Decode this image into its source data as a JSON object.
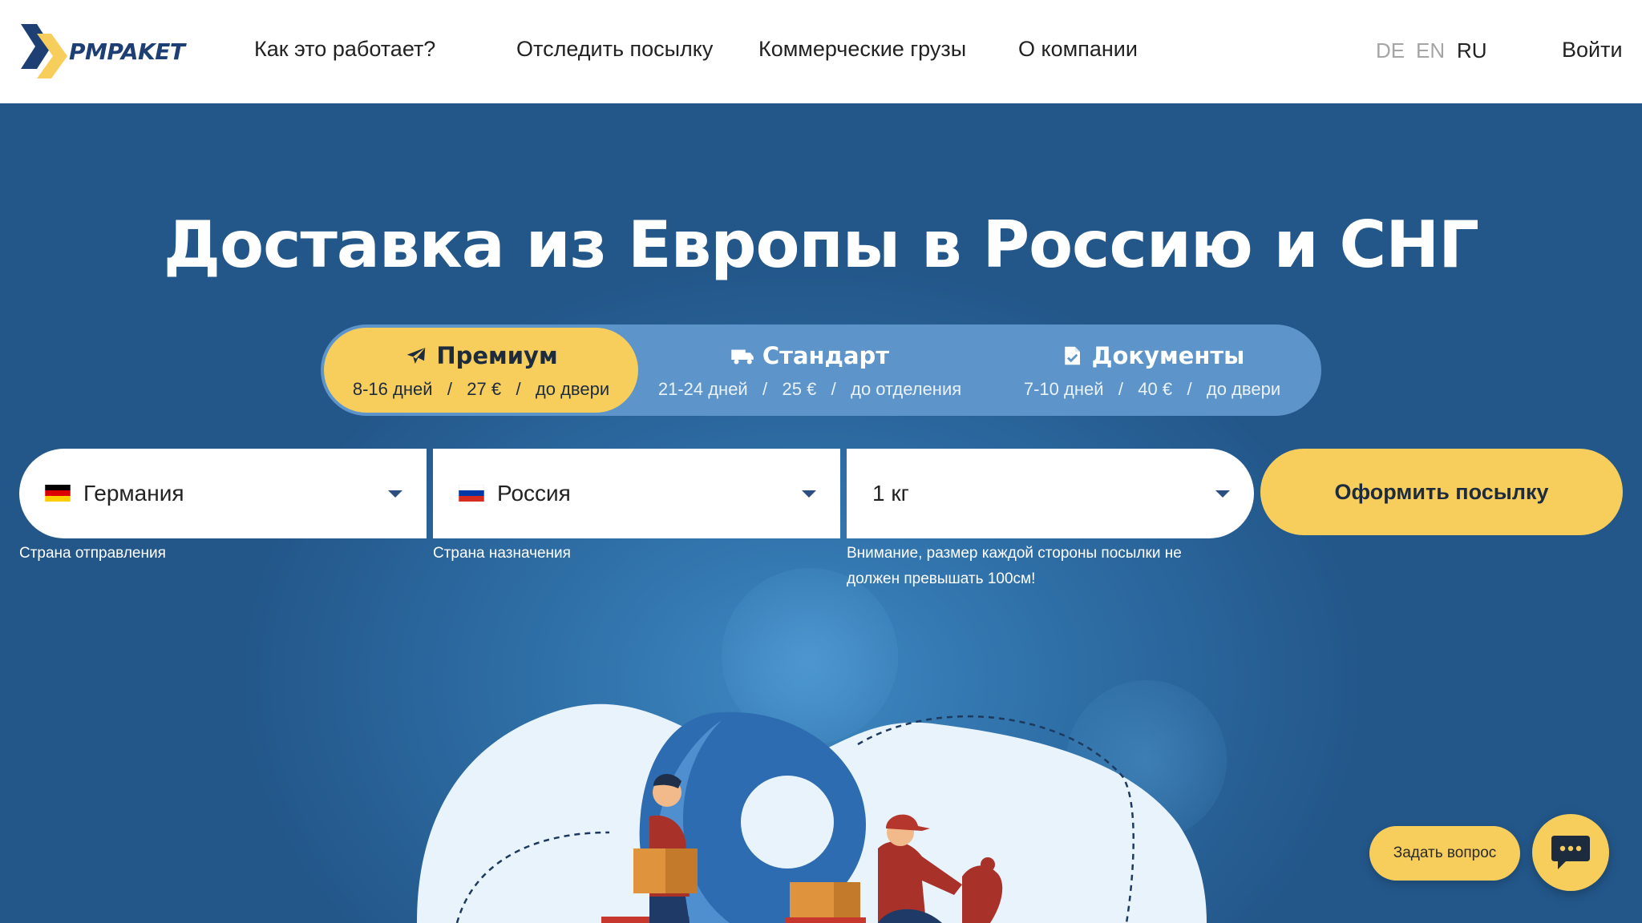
{
  "brand": {
    "name": "PMPAKET"
  },
  "nav": {
    "how_it_works": "Как это работает?",
    "track": "Отследить посылку",
    "commercial": "Коммерческие грузы",
    "about": "О компании"
  },
  "languages": [
    "DE",
    "EN",
    "RU"
  ],
  "active_language": "RU",
  "login": "Войти",
  "hero": {
    "title": "Доставка из Европы в Россию и СНГ"
  },
  "tabs": [
    {
      "title": "Премиум",
      "subtitle": "8-16 дней   /   27 €   /   до двери",
      "icon": "airplane-icon",
      "active": true
    },
    {
      "title": "Стандарт",
      "subtitle": "21-24 дней   /   25 €   /   до отделения",
      "icon": "truck-icon",
      "active": false
    },
    {
      "title": "Документы",
      "subtitle": "7-10 дней   /   40 €   /   до двери",
      "icon": "document-icon",
      "active": false
    }
  ],
  "form": {
    "origin": {
      "value": "Германия",
      "caption": "Страна отправления",
      "flag": "germany-flag"
    },
    "destination": {
      "value": "Россия",
      "caption": "Страна назначения",
      "flag": "russia-flag"
    },
    "weight": {
      "value": "1 кг",
      "caption": "Внимание, размер каждой стороны посылки не должен превышать 100см!"
    },
    "submit": "Оформить посылку"
  },
  "chat": {
    "ask_label": "Задать вопрос",
    "icon": "chat-bubble-icon"
  },
  "colors": {
    "accent": "#f7ce5c",
    "hero_bg": "#23578a",
    "tabs_bg": "#5d94c9",
    "brand_blue": "#1e3f73"
  }
}
